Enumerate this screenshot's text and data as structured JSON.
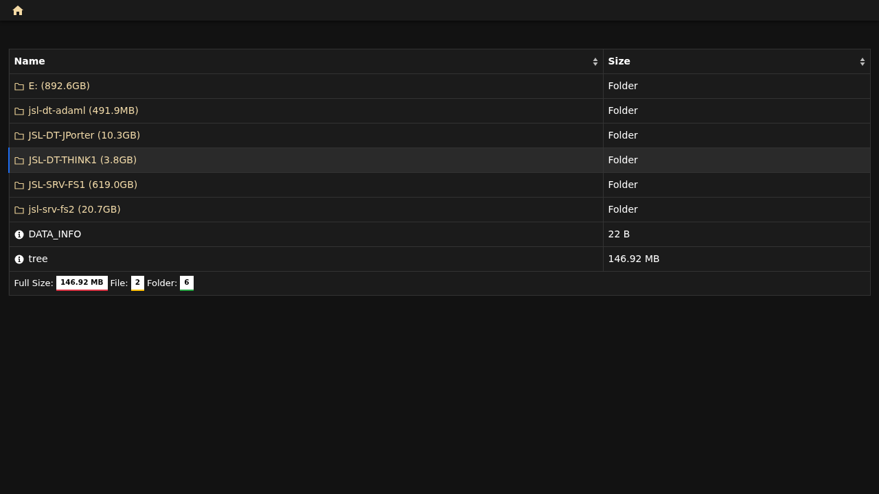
{
  "columns": [
    {
      "label": "Name"
    },
    {
      "label": "Size"
    }
  ],
  "rows": [
    {
      "kind": "folder",
      "name": "E: (892.6GB)",
      "size": "Folder",
      "selected": false
    },
    {
      "kind": "folder",
      "name": "jsl-dt-adaml (491.9MB)",
      "size": "Folder",
      "selected": false
    },
    {
      "kind": "folder",
      "name": "JSL-DT-JPorter (10.3GB)",
      "size": "Folder",
      "selected": false
    },
    {
      "kind": "folder",
      "name": "JSL-DT-THINK1 (3.8GB)",
      "size": "Folder",
      "selected": true
    },
    {
      "kind": "folder",
      "name": "JSL-SRV-FS1 (619.0GB)",
      "size": "Folder",
      "selected": false
    },
    {
      "kind": "folder",
      "name": "jsl-srv-fs2 (20.7GB)",
      "size": "Folder",
      "selected": false
    },
    {
      "kind": "file",
      "name": "DATA_INFO",
      "size": "22 B",
      "selected": false
    },
    {
      "kind": "file",
      "name": "tree",
      "size": "146.92 MB",
      "selected": false
    }
  ],
  "summary": [
    {
      "label": "Full Size:",
      "value": "146.92 MB",
      "color": "#dc3545"
    },
    {
      "label": "File:",
      "value": "2",
      "color": "#ffc107"
    },
    {
      "label": "Folder:",
      "value": "6",
      "color": "#28a745"
    }
  ]
}
